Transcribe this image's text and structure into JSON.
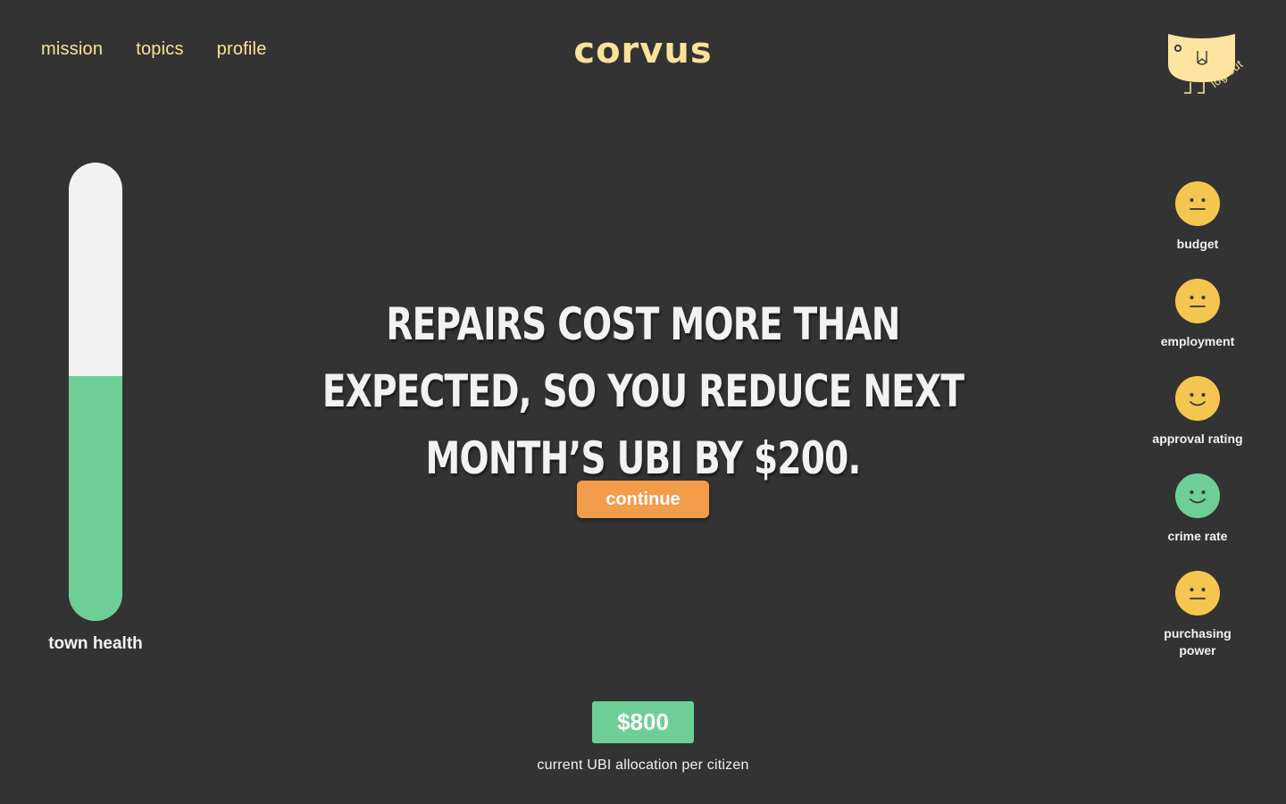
{
  "nav": {
    "items": [
      {
        "label": "mission"
      },
      {
        "label": "topics"
      },
      {
        "label": "profile"
      }
    ]
  },
  "logo": "corvus",
  "account": {
    "logout_label": "log out",
    "avatar_icon": "bird-icon"
  },
  "town_health": {
    "label": "town health",
    "level": 0.535,
    "fill_color": "#6ecf96"
  },
  "event": {
    "message": "Repairs cost more than expected, so you reduce next month’s UBI by $200.",
    "continue_label": "continue"
  },
  "indicators": [
    {
      "label": "budget",
      "mood": "neutral",
      "color": "#f5c64f",
      "icon": "neutral-face-icon"
    },
    {
      "label": "employment",
      "mood": "neutral",
      "color": "#f5c64f",
      "icon": "neutral-face-icon"
    },
    {
      "label": "approval rating",
      "mood": "happy",
      "color": "#f5c64f",
      "icon": "smiling-face-icon"
    },
    {
      "label": "crime rate",
      "mood": "happy",
      "color": "#6ecf96",
      "icon": "smiling-face-icon"
    },
    {
      "label": "purchasing power",
      "mood": "neutral",
      "color": "#f5c64f",
      "icon": "neutral-face-icon"
    }
  ],
  "ubi": {
    "amount": "$800",
    "label": "current UBI allocation per citizen"
  },
  "colors": {
    "accent_text": "#fbe29a",
    "background": "#333333",
    "button": "#f39c4a",
    "positive": "#6ecf96",
    "neutral": "#f5c64f"
  }
}
